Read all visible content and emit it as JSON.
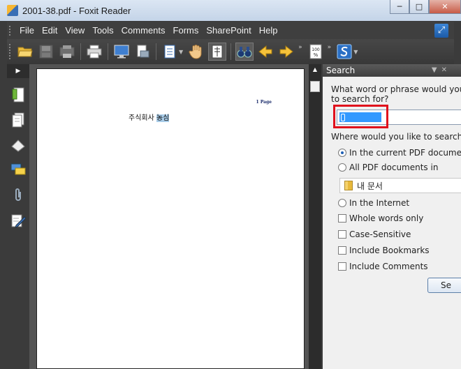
{
  "window": {
    "title": "2001-38.pdf - Foxit Reader",
    "controls": {
      "minimize": "─",
      "maximize": "□",
      "close": "✕"
    }
  },
  "menu": {
    "items": [
      "File",
      "Edit",
      "View",
      "Tools",
      "Comments",
      "Forms",
      "SharePoint",
      "Help"
    ]
  },
  "toolbar": {
    "zoom_icon_text": "100",
    "more_glyph": "»"
  },
  "document": {
    "page_label": "1 Page",
    "heading_prefix": "주식회사",
    "heading_highlight": "농심"
  },
  "search_panel": {
    "title": "Search",
    "question_line1": "What word or phrase would you",
    "question_line2": "to search for?",
    "search_value": "",
    "where_label": "Where would you like to search",
    "options": {
      "current_pdf": "In the current PDF docume",
      "all_pdf": "All PDF documents in",
      "folder": "내 문서",
      "internet": "In the Internet",
      "whole_words": "Whole words only",
      "case_sensitive": "Case-Sensitive",
      "include_bookmarks": "Include Bookmarks",
      "include_comments": "Include Comments"
    },
    "search_button": "Se"
  }
}
